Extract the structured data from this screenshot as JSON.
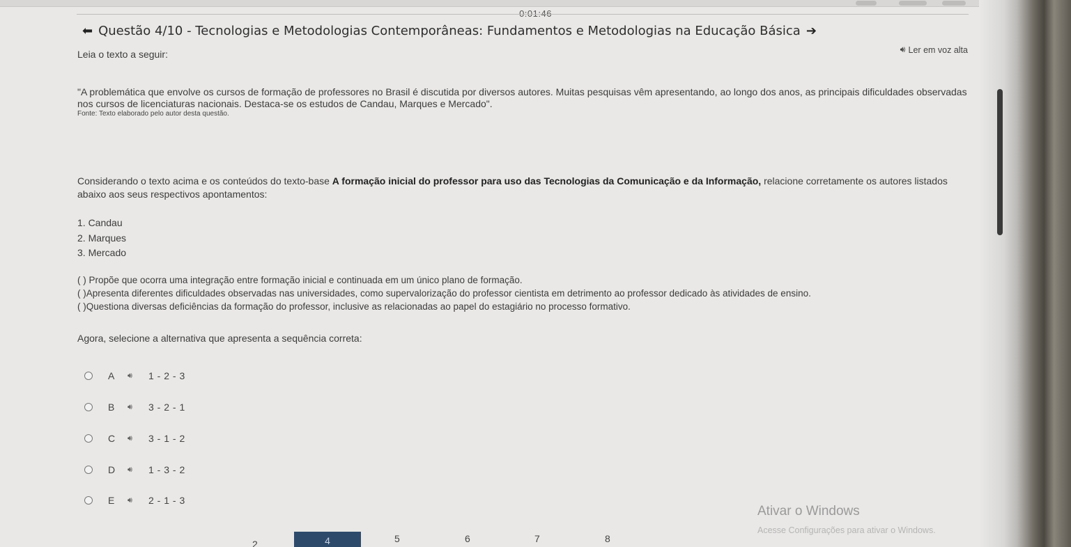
{
  "timer": "0:01:46",
  "header": {
    "title": "Questão 4/10 - Tecnologias e Metodologias Contemporâneas: Fundamentos e Metodologias na Educação Básica",
    "prev_icon": "arrow-left-icon",
    "next_icon": "arrow-right-icon"
  },
  "tts": {
    "label": "Ler em voz alta",
    "icon": "speaker-icon"
  },
  "question": {
    "lead": "Leia o texto a seguir:",
    "quote": "\"A problemática que envolve os cursos de formação de professores no Brasil é discutida por diversos autores. Muitas pesquisas vêm apresentando, ao longo dos anos, as principais dificuldades observadas nos cursos de licenciaturas nacionais. Destaca-se os estudos de Candau, Marques e Mercado\".",
    "source": "Fonte: Texto elaborado pelo autor desta questão.",
    "consider_pre": "Considerando o texto acima e os conteúdos do texto-base ",
    "consider_bold": "A formação inicial do professor para uso das Tecnologias da Comunicação e da Informação,",
    "consider_post": " relacione corretamente os autores listados abaixo aos seus respectivos apontamentos:",
    "authors": [
      "1. Candau",
      "2. Marques",
      "3. Mercado"
    ],
    "statements": [
      "(   ) Propõe que ocorra uma integração entre formação inicial e continuada em um único plano de formação.",
      "(   )Apresenta diferentes dificuldades observadas nas universidades, como supervalorização do professor cientista em detrimento ao professor dedicado às atividades de ensino.",
      "( )Questiona diversas deficiências da formação do professor, inclusive as relacionadas ao papel do estagiário no processo formativo."
    ],
    "prompt": "Agora, selecione a alternativa que apresenta a sequência correta:"
  },
  "options": [
    {
      "letter": "A",
      "value": "1 - 2 - 3"
    },
    {
      "letter": "B",
      "value": "3 - 2 - 1"
    },
    {
      "letter": "C",
      "value": "3 - 1 - 2"
    },
    {
      "letter": "D",
      "value": "1 - 3 - 2"
    },
    {
      "letter": "E",
      "value": "2 - 1 - 3"
    }
  ],
  "nav": {
    "numbers": [
      "2",
      "4",
      "5",
      "6",
      "7",
      "8"
    ],
    "current": "4"
  },
  "watermark": {
    "title": "Ativar o Windows",
    "subtitle": "Acesse Configurações para ativar o Windows."
  }
}
